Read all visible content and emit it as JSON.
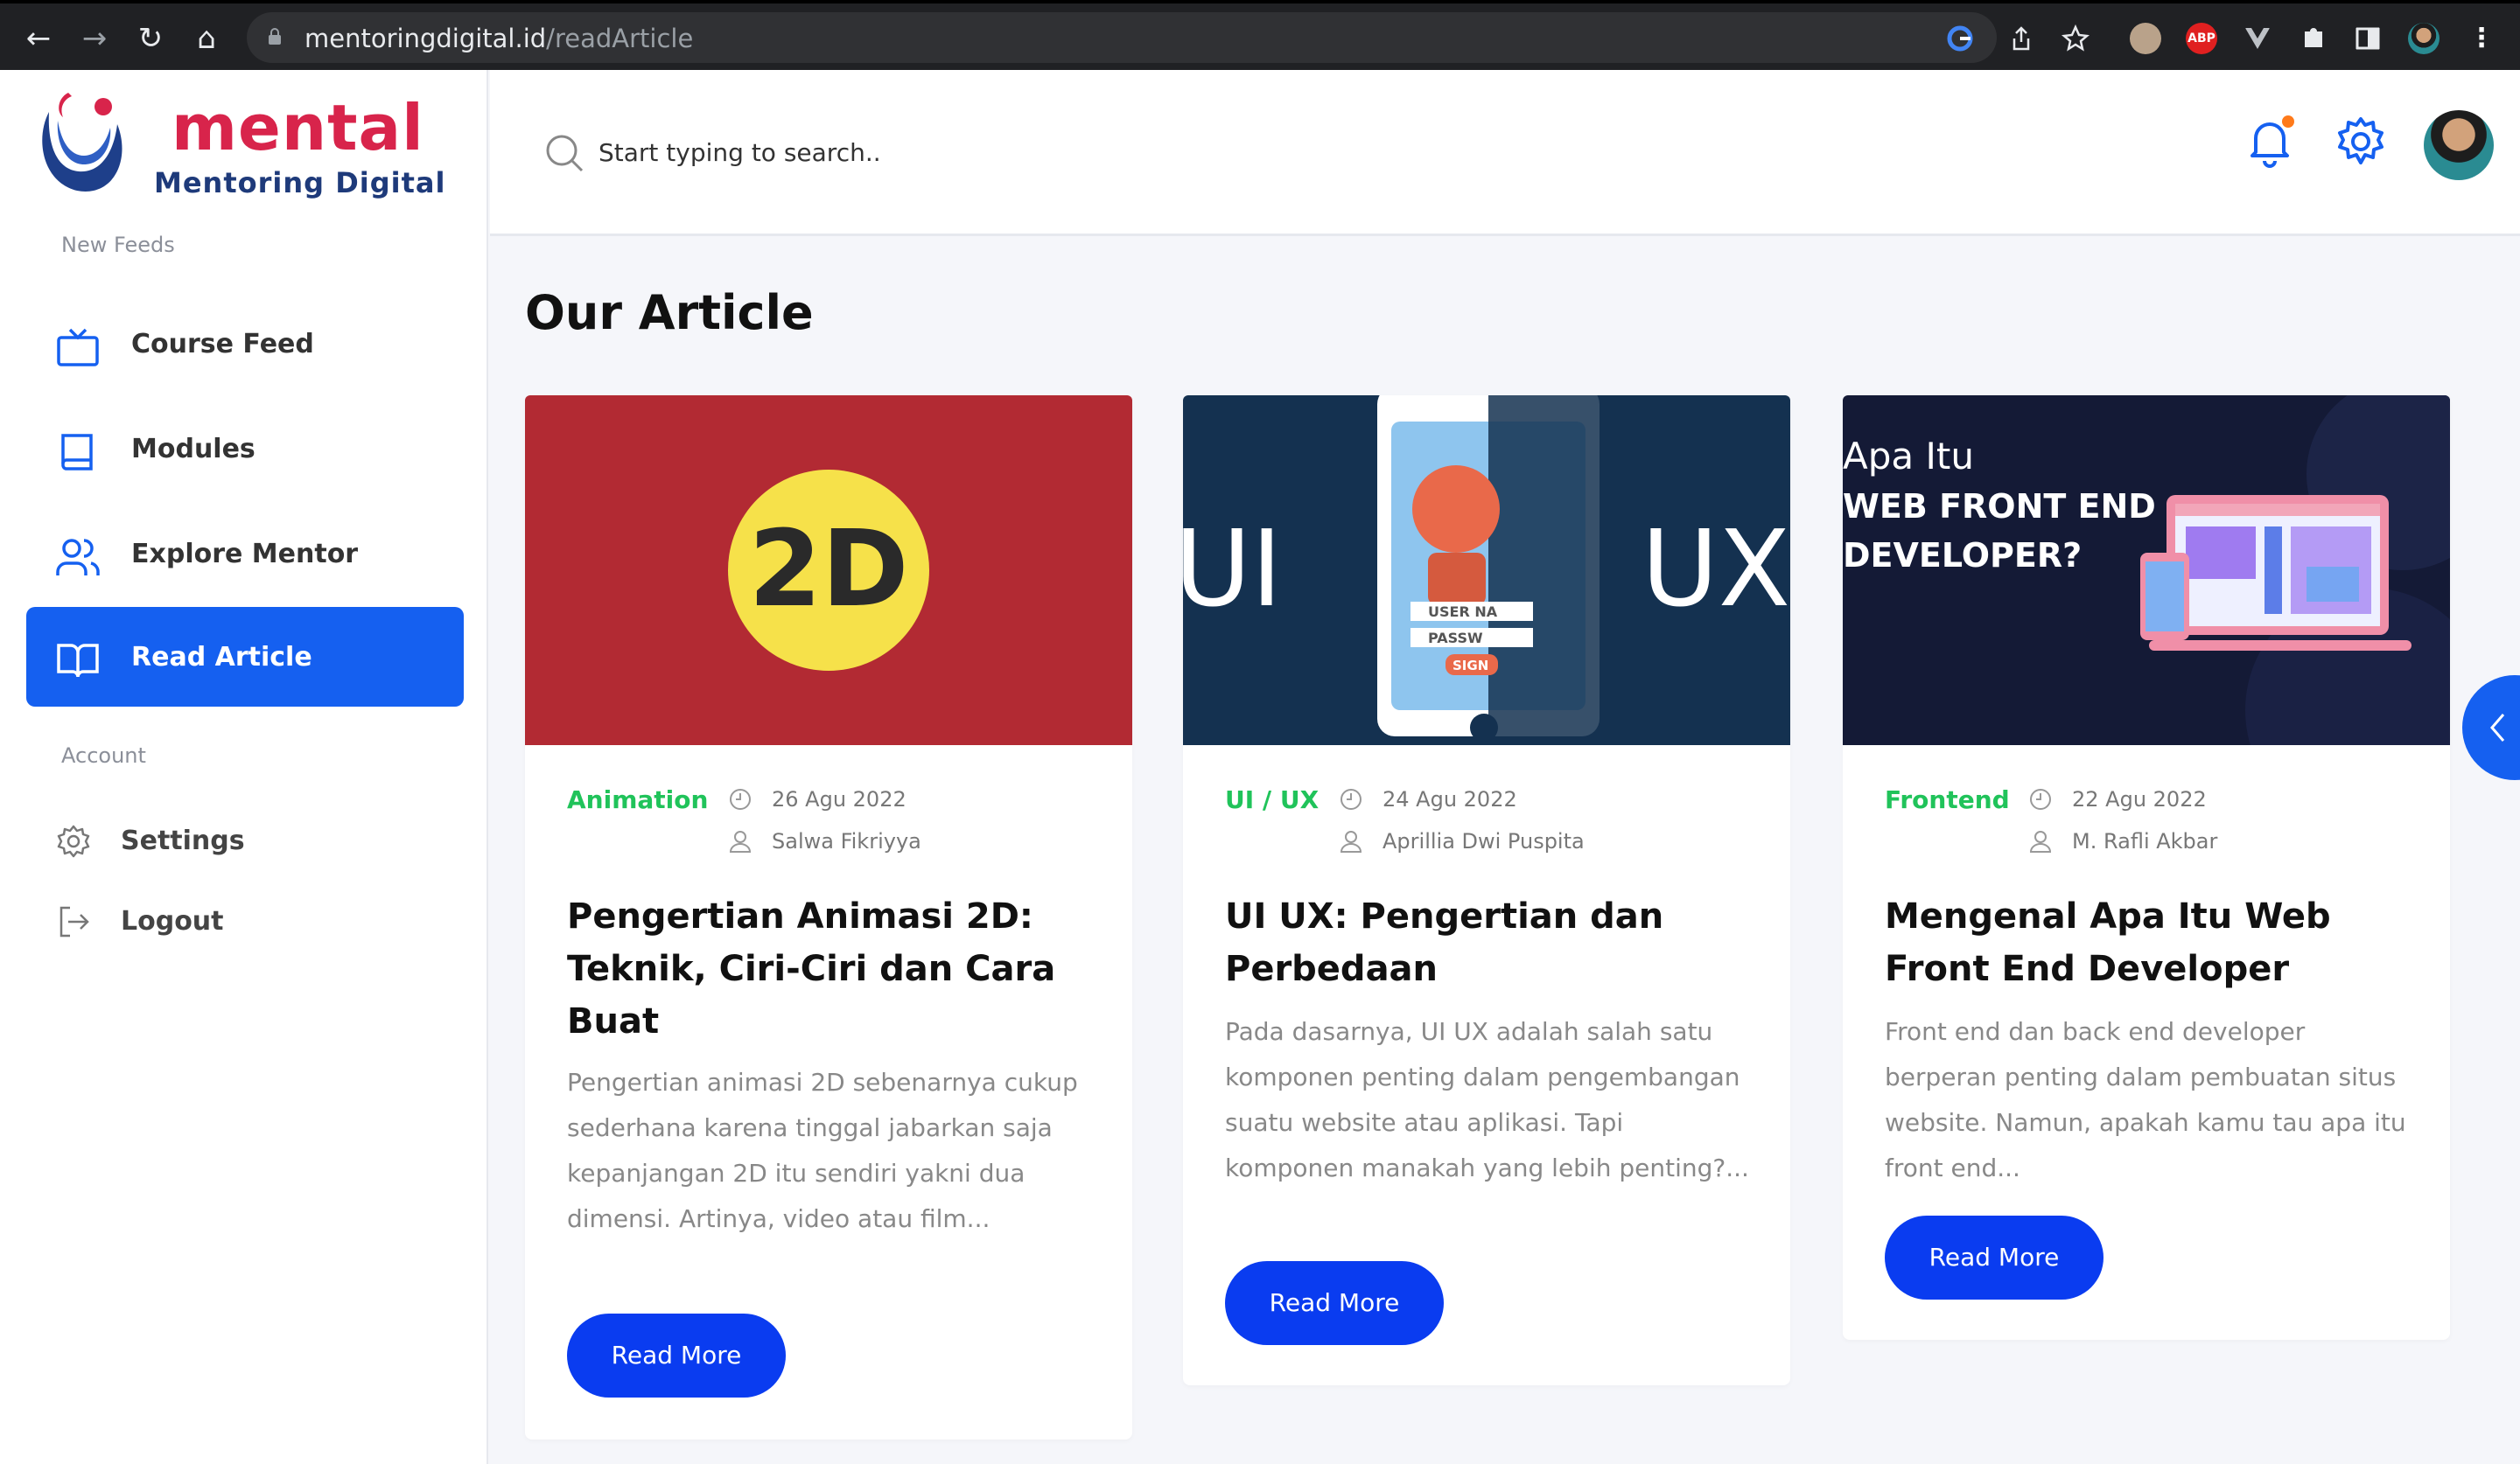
{
  "browser": {
    "url_host": "mentoringdigital.id",
    "url_path": "/readArticle",
    "extensions": [
      "google-icon",
      "share-icon",
      "star-icon",
      "owl-extension-icon",
      "adblock-icon",
      "vue-devtools-icon",
      "puzzle-icon",
      "sidepanel-icon",
      "profile-icon",
      "menu-icon"
    ],
    "abp_label": "ABP"
  },
  "brand": {
    "name": "mental",
    "tagline": "Mentoring Digital",
    "color_primary": "#d8244b",
    "color_secondary": "#1e3a7a"
  },
  "sidebar": {
    "feeds_label": "New Feeds",
    "items": [
      {
        "label": "Course Feed",
        "icon": "tv-icon"
      },
      {
        "label": "Modules",
        "icon": "book-icon"
      },
      {
        "label": "Explore Mentor",
        "icon": "users-icon"
      },
      {
        "label": "Read Article",
        "icon": "open-book-icon",
        "active": true
      }
    ],
    "account_label": "Account",
    "account_items": [
      {
        "label": "Settings",
        "icon": "gear-icon"
      },
      {
        "label": "Logout",
        "icon": "logout-icon"
      }
    ]
  },
  "header": {
    "search_placeholder": "Start typing to search.."
  },
  "page": {
    "title_light": "Our ",
    "title_bold": "Article",
    "accent": "#1560f0"
  },
  "articles": [
    {
      "category": "Animation",
      "date": "26 Agu 2022",
      "author": "Salwa Fikriyya",
      "title": "Pengertian Animasi 2D: Teknik, Ciri-Ciri dan Cara Buat",
      "excerpt": "Pengertian animasi 2D sebenarnya cukup sederhana karena tinggal jabarkan saja kepanjangan 2D itu sendiri yakni dua dimensi. Artinya, video atau film...",
      "button": "Read More",
      "thumb_text": "2D"
    },
    {
      "category": "UI / UX",
      "date": "24 Agu 2022",
      "author": "Aprillia Dwi Puspita",
      "title": "UI UX: Pengertian dan Perbedaan",
      "excerpt": "Pada dasarnya, UI UX adalah salah satu komponen penting dalam pengembangan suatu website atau aplikasi. Tapi komponen manakah yang lebih penting?...",
      "button": "Read More",
      "thumb_left": "UI",
      "thumb_right": "UX",
      "thumb_user": "USER NA",
      "thumb_pass": "PASSW",
      "thumb_sign": "SIGN"
    },
    {
      "category": "Frontend",
      "date": "22 Agu 2022",
      "author": "M. Rafli Akbar",
      "title": "Mengenal Apa Itu Web Front End Developer",
      "excerpt": "Front end dan back end developer berperan penting dalam pembuatan situs website. Namun, apakah kamu tau apa itu front end...",
      "button": "Read More",
      "thumb_line1": "Apa Itu",
      "thumb_line2": "WEB FRONT END",
      "thumb_line3": "DEVELOPER?"
    }
  ]
}
